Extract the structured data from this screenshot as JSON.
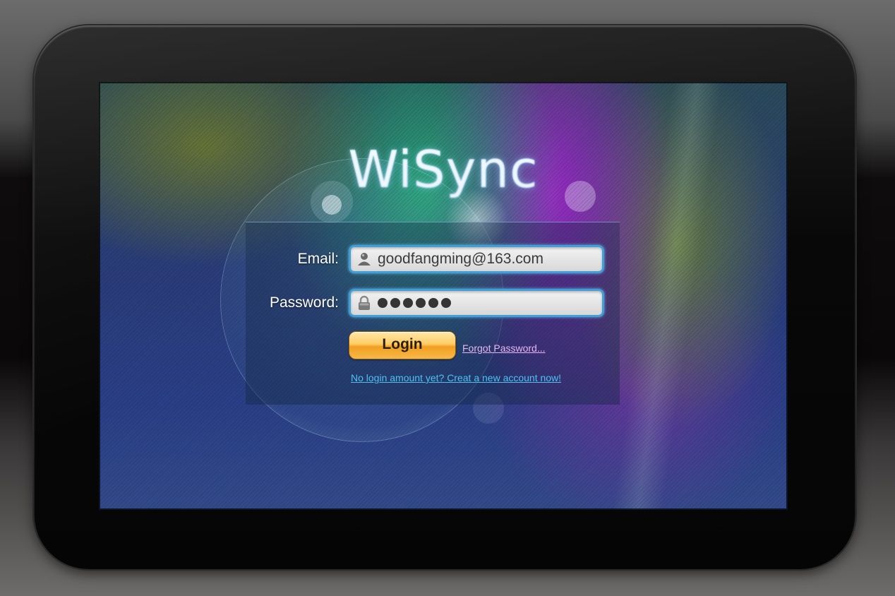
{
  "app": {
    "logo_text": "WiSync"
  },
  "login": {
    "email_label": "Email:",
    "email_value": "goodfangming@163.com",
    "password_label": "Password:",
    "password_mask_length": 6,
    "login_button": "Login",
    "forgot_password": "Forgot Password...",
    "signup_prompt": "No login amount yet?  Creat a new account now!"
  },
  "icons": {
    "email_field": "user-icon",
    "password_field": "lock-icon"
  },
  "colors": {
    "logo": "#6fb8f0",
    "field_border": "#3f9fd8",
    "login_button": "#f5b53c",
    "forgot_link": "#e7b6f2",
    "signup_link": "#50c0f0"
  }
}
